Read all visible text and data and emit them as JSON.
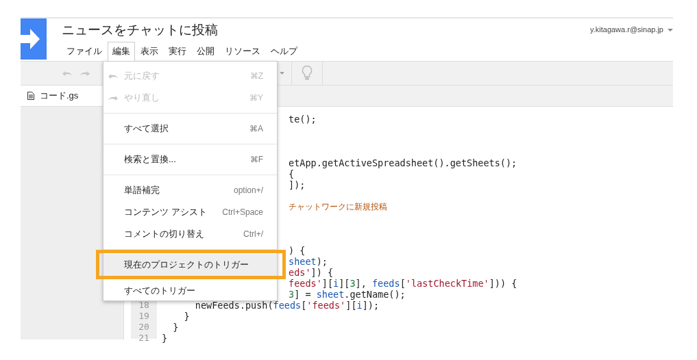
{
  "project": {
    "title": "ニュースをチャットに投稿",
    "account": "y.kitagawa.r@sinap.jp"
  },
  "menubar": [
    {
      "label": "ファイル",
      "selected": false
    },
    {
      "label": "編集",
      "selected": true
    },
    {
      "label": "表示",
      "selected": false
    },
    {
      "label": "実行",
      "selected": false
    },
    {
      "label": "公開",
      "selected": false
    },
    {
      "label": "リソース",
      "selected": false
    },
    {
      "label": "ヘルプ",
      "selected": false
    }
  ],
  "file_tab": {
    "label": "コード.gs"
  },
  "code_lines": [
    {
      "cut": true,
      "tokens": [
        {
          "kind": "plain",
          "text": "te();"
        }
      ]
    },
    {
      "cut": true
    },
    {
      "cut": true
    },
    {
      "cut": true
    },
    {
      "cut": true,
      "tokens": [
        {
          "kind": "plain",
          "text": "etApp.getActiveSpreadsheet().getSheets();"
        }
      ]
    },
    {
      "cut": true,
      "tokens": [
        {
          "kind": "plain",
          "text": "{"
        }
      ]
    },
    {
      "cut": true,
      "tokens": [
        {
          "kind": "plain",
          "text": "]);"
        }
      ]
    },
    {
      "cut": true
    },
    {
      "cut": true,
      "tokens": [
        {
          "kind": "comment",
          "text": "チャットワークに新規投稿"
        }
      ]
    },
    {
      "cut": true
    },
    {
      "cut": true
    },
    {
      "cut": true
    },
    {
      "cut": true,
      "tokens": [
        {
          "kind": "plain",
          "text": ") {"
        }
      ]
    },
    {
      "cut": true,
      "tokens": [
        {
          "kind": "var",
          "text": "sheet"
        },
        {
          "kind": "plain",
          "text": ");"
        }
      ]
    },
    {
      "cut": true,
      "tokens": [
        {
          "kind": "string",
          "text": "eds'"
        },
        {
          "kind": "plain",
          "text": "]) {"
        }
      ]
    },
    {
      "cut": true,
      "tokens": [
        {
          "kind": "string",
          "text": "feeds'"
        },
        {
          "kind": "plain",
          "text": "]["
        },
        {
          "kind": "var",
          "text": "i"
        },
        {
          "kind": "plain",
          "text": "]["
        },
        {
          "kind": "number",
          "text": "3"
        },
        {
          "kind": "plain",
          "text": "], "
        },
        {
          "kind": "var",
          "text": "feeds"
        },
        {
          "kind": "plain",
          "text": "["
        },
        {
          "kind": "string",
          "text": "'lastCheckTime'"
        },
        {
          "kind": "plain",
          "text": "])) {"
        }
      ]
    },
    {
      "cut": true,
      "tokens": [
        {
          "kind": "number",
          "text": "3"
        },
        {
          "kind": "plain",
          "text": "] = "
        },
        {
          "kind": "var",
          "text": "sheet"
        },
        {
          "kind": "plain",
          "text": ".getName();"
        }
      ]
    },
    {
      "cut": false,
      "number": "18",
      "tokens": [
        {
          "kind": "plain",
          "text": "      newFeeds.push("
        },
        {
          "kind": "var",
          "text": "feeds"
        },
        {
          "kind": "plain",
          "text": "["
        },
        {
          "kind": "string",
          "text": "'feeds'"
        },
        {
          "kind": "plain",
          "text": "]["
        },
        {
          "kind": "var",
          "text": "i"
        },
        {
          "kind": "plain",
          "text": "]);"
        }
      ]
    },
    {
      "cut": false,
      "number": "19",
      "tokens": [
        {
          "kind": "plain",
          "text": "    }"
        }
      ]
    },
    {
      "cut": false,
      "number": "20",
      "tokens": [
        {
          "kind": "plain",
          "text": "  }"
        }
      ]
    },
    {
      "cut": false,
      "number": "21",
      "tokens": [
        {
          "kind": "plain",
          "text": "}"
        }
      ]
    }
  ],
  "edit_menu": [
    {
      "kind": "item",
      "label": "元に戻す",
      "shortcut": "⌘Z",
      "disabled": true,
      "selected": false
    },
    {
      "kind": "item",
      "label": "やり直し",
      "shortcut": "⌘Y",
      "disabled": true,
      "selected": false
    },
    {
      "kind": "separator"
    },
    {
      "kind": "item",
      "label": "すべて選択",
      "shortcut": "⌘A",
      "disabled": false,
      "selected": false
    },
    {
      "kind": "separator"
    },
    {
      "kind": "item",
      "label": "検索と置換...",
      "shortcut": "⌘F",
      "disabled": false,
      "selected": false
    },
    {
      "kind": "separator"
    },
    {
      "kind": "item",
      "label": "単語補完",
      "shortcut": "option+/",
      "disabled": false,
      "selected": false
    },
    {
      "kind": "item",
      "label": "コンテンツ アシスト",
      "shortcut": "Ctrl+Space",
      "disabled": false,
      "selected": false
    },
    {
      "kind": "item",
      "label": "コメントの切り替え",
      "shortcut": "Ctrl+/",
      "disabled": false,
      "selected": false
    },
    {
      "kind": "separator"
    },
    {
      "kind": "item",
      "label": "現在のプロジェクトのトリガー",
      "disabled": false,
      "selected": true
    },
    {
      "kind": "item",
      "label": "すべてのトリガー",
      "disabled": false,
      "selected": false
    }
  ]
}
